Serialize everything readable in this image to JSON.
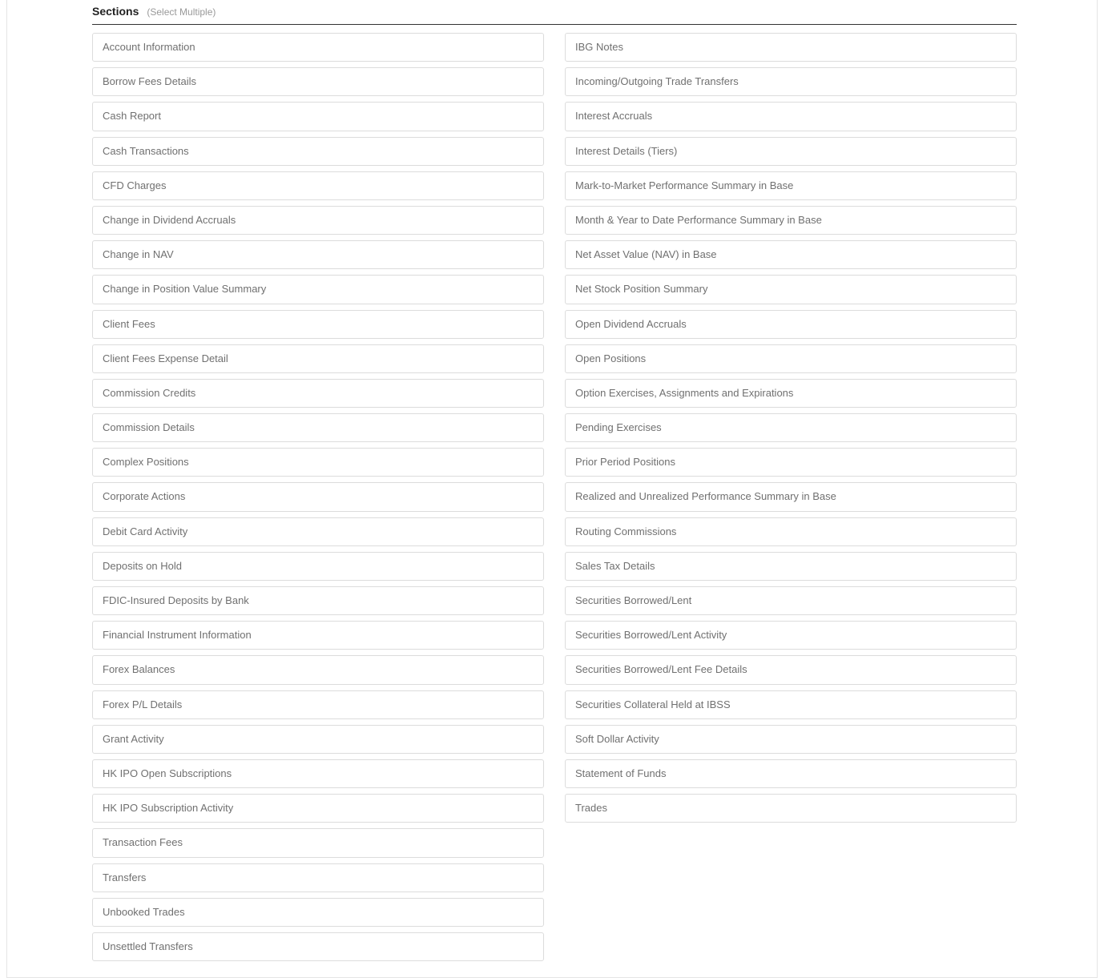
{
  "header": {
    "title": "Sections",
    "hint": "(Select Multiple)"
  },
  "columns": {
    "left": [
      "Account Information",
      "Borrow Fees Details",
      "Cash Report",
      "Cash Transactions",
      "CFD Charges",
      "Change in Dividend Accruals",
      "Change in NAV",
      "Change in Position Value Summary",
      "Client Fees",
      "Client Fees Expense Detail",
      "Commission Credits",
      "Commission Details",
      "Complex Positions",
      "Corporate Actions",
      "Debit Card Activity",
      "Deposits on Hold",
      "FDIC-Insured Deposits by Bank",
      "Financial Instrument Information",
      "Forex Balances",
      "Forex P/L Details",
      "Grant Activity",
      "HK IPO Open Subscriptions",
      "HK IPO Subscription Activity",
      "Transaction Fees",
      "Transfers",
      "Unbooked Trades",
      "Unsettled Transfers"
    ],
    "right": [
      "IBG Notes",
      "Incoming/Outgoing Trade Transfers",
      "Interest Accruals",
      "Interest Details (Tiers)",
      "Mark-to-Market Performance Summary in Base",
      "Month & Year to Date Performance Summary in Base",
      "Net Asset Value (NAV) in Base",
      "Net Stock Position Summary",
      "Open Dividend Accruals",
      "Open Positions",
      "Option Exercises, Assignments and Expirations",
      "Pending Exercises",
      "Prior Period Positions",
      "Realized and Unrealized Performance Summary in Base",
      "Routing Commissions",
      "Sales Tax Details",
      "Securities Borrowed/Lent",
      "Securities Borrowed/Lent Activity",
      "Securities Borrowed/Lent Fee Details",
      "Securities Collateral Held at IBSS",
      "Soft Dollar Activity",
      "Statement of Funds",
      "Trades"
    ]
  }
}
